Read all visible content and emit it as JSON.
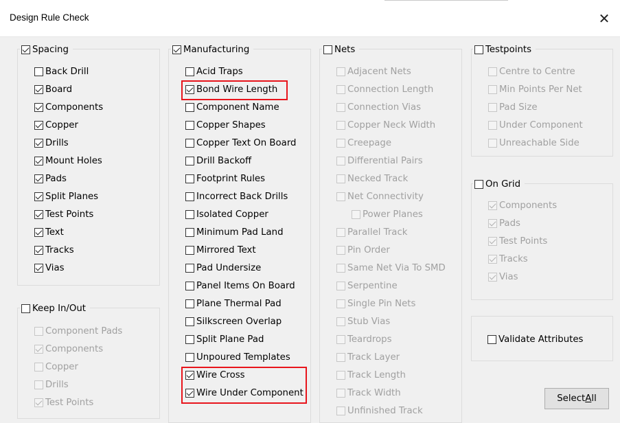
{
  "window": {
    "title": "Design Rule Check",
    "close_glyph": "✕"
  },
  "spacing": {
    "label": "Spacing",
    "checked": true,
    "items": [
      {
        "label": "Back Drill",
        "checked": false
      },
      {
        "label": "Board",
        "checked": true
      },
      {
        "label": "Components",
        "checked": true
      },
      {
        "label": "Copper",
        "checked": true
      },
      {
        "label": "Drills",
        "checked": true
      },
      {
        "label": "Mount Holes",
        "checked": true
      },
      {
        "label": "Pads",
        "checked": true
      },
      {
        "label": "Split Planes",
        "checked": true
      },
      {
        "label": "Test Points",
        "checked": true
      },
      {
        "label": "Text",
        "checked": true
      },
      {
        "label": "Tracks",
        "checked": true
      },
      {
        "label": "Vias",
        "checked": true
      }
    ]
  },
  "keep_in_out": {
    "label": "Keep In/Out",
    "checked": false,
    "items": [
      {
        "label": "Component Pads",
        "checked": false
      },
      {
        "label": "Components",
        "checked": true
      },
      {
        "label": "Copper",
        "checked": false
      },
      {
        "label": "Drills",
        "checked": false
      },
      {
        "label": "Test Points",
        "checked": true
      }
    ]
  },
  "manufacturing": {
    "label": "Manufacturing",
    "checked": true,
    "items": [
      {
        "label": "Acid Traps",
        "checked": false
      },
      {
        "label": "Bond Wire Length",
        "checked": true
      },
      {
        "label": "Component Name",
        "checked": false
      },
      {
        "label": "Copper Shapes",
        "checked": false
      },
      {
        "label": "Copper Text On Board",
        "checked": false
      },
      {
        "label": "Drill Backoff",
        "checked": false
      },
      {
        "label": "Footprint Rules",
        "checked": false
      },
      {
        "label": "Incorrect Back Drills",
        "checked": false
      },
      {
        "label": "Isolated Copper",
        "checked": false
      },
      {
        "label": "Minimum Pad Land",
        "checked": false
      },
      {
        "label": "Mirrored Text",
        "checked": false
      },
      {
        "label": "Pad Undersize",
        "checked": false
      },
      {
        "label": "Panel Items On Board",
        "checked": false
      },
      {
        "label": "Plane Thermal Pad",
        "checked": false
      },
      {
        "label": "Silkscreen Overlap",
        "checked": false
      },
      {
        "label": "Split Plane Pad",
        "checked": false
      },
      {
        "label": "Unpoured Templates",
        "checked": false
      },
      {
        "label": "Wire Cross",
        "checked": true
      },
      {
        "label": "Wire Under Component",
        "checked": true
      }
    ]
  },
  "nets": {
    "label": "Nets",
    "checked": false,
    "items": [
      {
        "label": "Adjacent Nets",
        "checked": false,
        "indent": false
      },
      {
        "label": "Connection Length",
        "checked": false,
        "indent": false
      },
      {
        "label": "Connection Vias",
        "checked": false,
        "indent": false
      },
      {
        "label": "Copper Neck Width",
        "checked": false,
        "indent": false
      },
      {
        "label": "Creepage",
        "checked": false,
        "indent": false
      },
      {
        "label": "Differential Pairs",
        "checked": false,
        "indent": false
      },
      {
        "label": "Necked Track",
        "checked": false,
        "indent": false
      },
      {
        "label": "Net Connectivity",
        "checked": false,
        "indent": false
      },
      {
        "label": "Power Planes",
        "checked": false,
        "indent": true
      },
      {
        "label": "Parallel Track",
        "checked": false,
        "indent": false
      },
      {
        "label": "Pin Order",
        "checked": false,
        "indent": false
      },
      {
        "label": "Same Net Via To SMD",
        "checked": false,
        "indent": false
      },
      {
        "label": "Serpentine",
        "checked": false,
        "indent": false
      },
      {
        "label": "Single Pin Nets",
        "checked": false,
        "indent": false
      },
      {
        "label": "Stub Vias",
        "checked": false,
        "indent": false
      },
      {
        "label": "Teardrops",
        "checked": false,
        "indent": false
      },
      {
        "label": "Track Layer",
        "checked": false,
        "indent": false
      },
      {
        "label": "Track Length",
        "checked": false,
        "indent": false
      },
      {
        "label": "Track Width",
        "checked": false,
        "indent": false
      },
      {
        "label": "Unfinished Track",
        "checked": false,
        "indent": false
      }
    ]
  },
  "testpoints": {
    "label": "Testpoints",
    "checked": false,
    "items": [
      {
        "label": "Centre to Centre",
        "checked": false
      },
      {
        "label": "Min Points Per Net",
        "checked": false
      },
      {
        "label": "Pad Size",
        "checked": false
      },
      {
        "label": "Under Component",
        "checked": false
      },
      {
        "label": "Unreachable Side",
        "checked": false
      }
    ]
  },
  "on_grid": {
    "label": "On Grid",
    "checked": false,
    "items": [
      {
        "label": "Components",
        "checked": true
      },
      {
        "label": "Pads",
        "checked": true
      },
      {
        "label": "Test Points",
        "checked": true
      },
      {
        "label": "Tracks",
        "checked": true
      },
      {
        "label": "Vias",
        "checked": true
      }
    ]
  },
  "validate_attributes": {
    "label": "Validate Attributes",
    "checked": false
  },
  "select_all": {
    "label_prefix": "Select ",
    "label_accel": "A",
    "label_suffix": "ll"
  },
  "colors": {
    "highlight": "#e8141b",
    "dialog_bg": "#f0f0f0"
  }
}
